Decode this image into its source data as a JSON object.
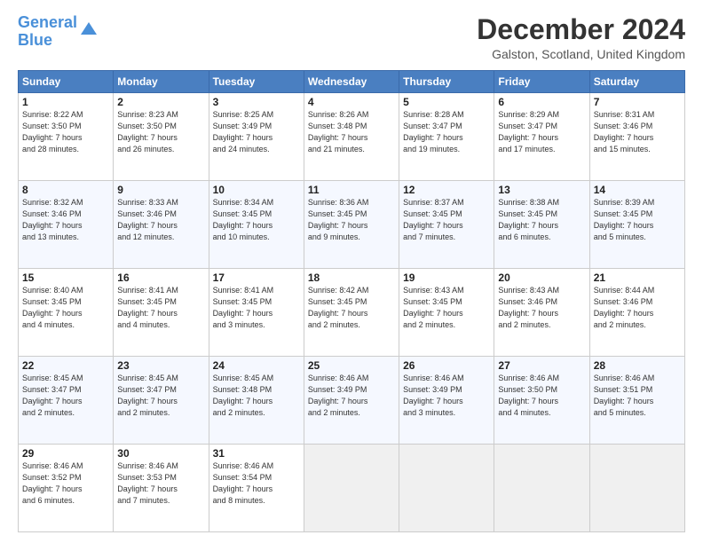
{
  "header": {
    "logo_line1": "General",
    "logo_line2": "Blue",
    "month_title": "December 2024",
    "location": "Galston, Scotland, United Kingdom"
  },
  "days_of_week": [
    "Sunday",
    "Monday",
    "Tuesday",
    "Wednesday",
    "Thursday",
    "Friday",
    "Saturday"
  ],
  "weeks": [
    [
      {
        "day": "1",
        "info": "Sunrise: 8:22 AM\nSunset: 3:50 PM\nDaylight: 7 hours\nand 28 minutes."
      },
      {
        "day": "2",
        "info": "Sunrise: 8:23 AM\nSunset: 3:50 PM\nDaylight: 7 hours\nand 26 minutes."
      },
      {
        "day": "3",
        "info": "Sunrise: 8:25 AM\nSunset: 3:49 PM\nDaylight: 7 hours\nand 24 minutes."
      },
      {
        "day": "4",
        "info": "Sunrise: 8:26 AM\nSunset: 3:48 PM\nDaylight: 7 hours\nand 21 minutes."
      },
      {
        "day": "5",
        "info": "Sunrise: 8:28 AM\nSunset: 3:47 PM\nDaylight: 7 hours\nand 19 minutes."
      },
      {
        "day": "6",
        "info": "Sunrise: 8:29 AM\nSunset: 3:47 PM\nDaylight: 7 hours\nand 17 minutes."
      },
      {
        "day": "7",
        "info": "Sunrise: 8:31 AM\nSunset: 3:46 PM\nDaylight: 7 hours\nand 15 minutes."
      }
    ],
    [
      {
        "day": "8",
        "info": "Sunrise: 8:32 AM\nSunset: 3:46 PM\nDaylight: 7 hours\nand 13 minutes."
      },
      {
        "day": "9",
        "info": "Sunrise: 8:33 AM\nSunset: 3:46 PM\nDaylight: 7 hours\nand 12 minutes."
      },
      {
        "day": "10",
        "info": "Sunrise: 8:34 AM\nSunset: 3:45 PM\nDaylight: 7 hours\nand 10 minutes."
      },
      {
        "day": "11",
        "info": "Sunrise: 8:36 AM\nSunset: 3:45 PM\nDaylight: 7 hours\nand 9 minutes."
      },
      {
        "day": "12",
        "info": "Sunrise: 8:37 AM\nSunset: 3:45 PM\nDaylight: 7 hours\nand 7 minutes."
      },
      {
        "day": "13",
        "info": "Sunrise: 8:38 AM\nSunset: 3:45 PM\nDaylight: 7 hours\nand 6 minutes."
      },
      {
        "day": "14",
        "info": "Sunrise: 8:39 AM\nSunset: 3:45 PM\nDaylight: 7 hours\nand 5 minutes."
      }
    ],
    [
      {
        "day": "15",
        "info": "Sunrise: 8:40 AM\nSunset: 3:45 PM\nDaylight: 7 hours\nand 4 minutes."
      },
      {
        "day": "16",
        "info": "Sunrise: 8:41 AM\nSunset: 3:45 PM\nDaylight: 7 hours\nand 4 minutes."
      },
      {
        "day": "17",
        "info": "Sunrise: 8:41 AM\nSunset: 3:45 PM\nDaylight: 7 hours\nand 3 minutes."
      },
      {
        "day": "18",
        "info": "Sunrise: 8:42 AM\nSunset: 3:45 PM\nDaylight: 7 hours\nand 2 minutes."
      },
      {
        "day": "19",
        "info": "Sunrise: 8:43 AM\nSunset: 3:45 PM\nDaylight: 7 hours\nand 2 minutes."
      },
      {
        "day": "20",
        "info": "Sunrise: 8:43 AM\nSunset: 3:46 PM\nDaylight: 7 hours\nand 2 minutes."
      },
      {
        "day": "21",
        "info": "Sunrise: 8:44 AM\nSunset: 3:46 PM\nDaylight: 7 hours\nand 2 minutes."
      }
    ],
    [
      {
        "day": "22",
        "info": "Sunrise: 8:45 AM\nSunset: 3:47 PM\nDaylight: 7 hours\nand 2 minutes."
      },
      {
        "day": "23",
        "info": "Sunrise: 8:45 AM\nSunset: 3:47 PM\nDaylight: 7 hours\nand 2 minutes."
      },
      {
        "day": "24",
        "info": "Sunrise: 8:45 AM\nSunset: 3:48 PM\nDaylight: 7 hours\nand 2 minutes."
      },
      {
        "day": "25",
        "info": "Sunrise: 8:46 AM\nSunset: 3:49 PM\nDaylight: 7 hours\nand 2 minutes."
      },
      {
        "day": "26",
        "info": "Sunrise: 8:46 AM\nSunset: 3:49 PM\nDaylight: 7 hours\nand 3 minutes."
      },
      {
        "day": "27",
        "info": "Sunrise: 8:46 AM\nSunset: 3:50 PM\nDaylight: 7 hours\nand 4 minutes."
      },
      {
        "day": "28",
        "info": "Sunrise: 8:46 AM\nSunset: 3:51 PM\nDaylight: 7 hours\nand 5 minutes."
      }
    ],
    [
      {
        "day": "29",
        "info": "Sunrise: 8:46 AM\nSunset: 3:52 PM\nDaylight: 7 hours\nand 6 minutes."
      },
      {
        "day": "30",
        "info": "Sunrise: 8:46 AM\nSunset: 3:53 PM\nDaylight: 7 hours\nand 7 minutes."
      },
      {
        "day": "31",
        "info": "Sunrise: 8:46 AM\nSunset: 3:54 PM\nDaylight: 7 hours\nand 8 minutes."
      },
      {
        "day": "",
        "info": ""
      },
      {
        "day": "",
        "info": ""
      },
      {
        "day": "",
        "info": ""
      },
      {
        "day": "",
        "info": ""
      }
    ]
  ]
}
